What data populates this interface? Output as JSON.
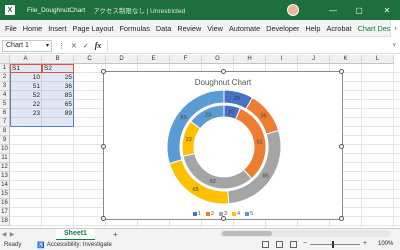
{
  "titlebar": {
    "file_name": "File_DoughnutChart",
    "status": "アクセス制限なし | Unrestricted",
    "minimize": "—",
    "maximize": "▢",
    "close": "✕"
  },
  "ribbon": {
    "tabs": [
      "File",
      "Home",
      "Insert",
      "Page Layout",
      "Formulas",
      "Data",
      "Review",
      "View",
      "Automate",
      "Developer",
      "Help",
      "Acrobat",
      "Chart Design"
    ],
    "more": "›"
  },
  "formula_bar": {
    "name_box": "Chart 1",
    "name_box_dropdown": "▾",
    "menu": "⋮",
    "cancel": "✕",
    "enter": "✓",
    "fx": "fx",
    "value": "",
    "expand": "˅"
  },
  "grid": {
    "columns": [
      "A",
      "B",
      "C",
      "D",
      "E",
      "F",
      "G",
      "H",
      "I",
      "J",
      "K",
      "L"
    ],
    "rows": [
      "1",
      "2",
      "3",
      "4",
      "5",
      "6",
      "7",
      "8",
      "9",
      "10",
      "11",
      "12",
      "13",
      "14",
      "15",
      "16",
      "17",
      "18"
    ],
    "headers": [
      "S1",
      "S2"
    ],
    "data": [
      [
        "10",
        "25"
      ],
      [
        "51",
        "36"
      ],
      [
        "52",
        "85"
      ],
      [
        "22",
        "65"
      ],
      [
        "23",
        "89"
      ]
    ]
  },
  "chart_data": {
    "type": "doughnut",
    "title": "Doughnut Chart",
    "categories": [
      "1",
      "2",
      "3",
      "4",
      "5"
    ],
    "series": [
      {
        "name": "S1",
        "values": [
          10,
          51,
          52,
          22,
          23
        ]
      },
      {
        "name": "S2",
        "values": [
          25,
          36,
          85,
          65,
          89
        ]
      }
    ],
    "colors": [
      "#4472c4",
      "#ed7d31",
      "#a5a5a5",
      "#ffc000",
      "#5b9bd5"
    ],
    "legend": "bottom",
    "label_color": "#404040"
  },
  "sheets": {
    "tabs": [
      "Sheet1"
    ],
    "add": "+",
    "prev": "◀",
    "next": "▶"
  },
  "status": {
    "ready": "Ready",
    "accessibility": "Accessibility: Investigate",
    "zoom": "100%",
    "zoom_minus": "−",
    "zoom_plus": "+"
  }
}
